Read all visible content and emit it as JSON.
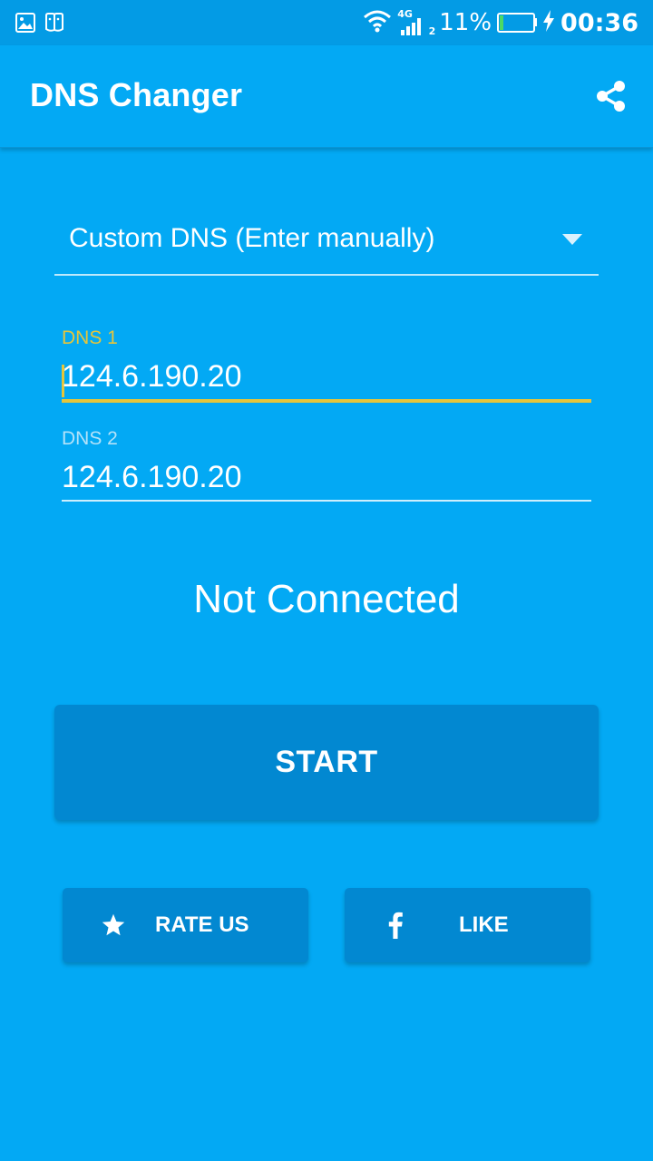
{
  "status_bar": {
    "left_icons": [
      "image-icon",
      "notification-app-icon"
    ],
    "signal_label": "4G",
    "sim_label": "2",
    "battery_percent": "11%",
    "battery_level": 0.11,
    "time": "00:36"
  },
  "app_bar": {
    "title": "DNS Changer",
    "share_icon": "share-icon"
  },
  "dns_selector": {
    "selected": "Custom DNS (Enter manually)"
  },
  "fields": {
    "dns1": {
      "label": "DNS 1",
      "value": "124.6.190.20"
    },
    "dns2": {
      "label": "DNS 2",
      "value": "124.6.190.20"
    }
  },
  "connection_status": "Not Connected",
  "buttons": {
    "start": "START",
    "rate_us": "RATE US",
    "like": "LIKE"
  },
  "colors": {
    "background": "#03A9F4",
    "status_bar": "#039BE5",
    "button": "#0288D1",
    "focus_accent": "#E5C53B",
    "battery_fill": "#4CD964"
  }
}
